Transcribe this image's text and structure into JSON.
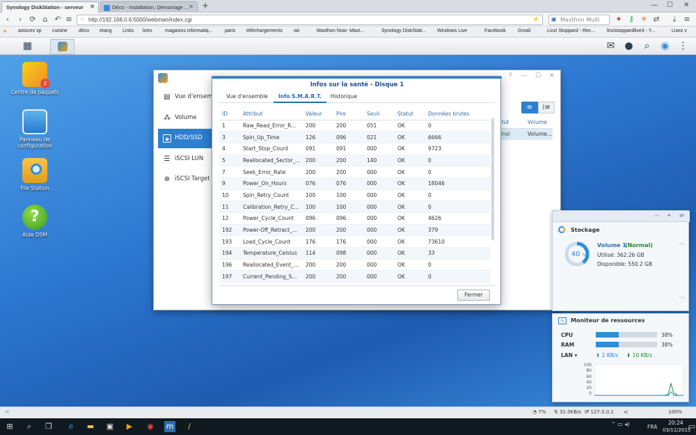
{
  "browser": {
    "tabs": [
      {
        "label": "Synology DiskStation - serveur",
        "active": true
      },
      {
        "label": "Déco - Installation, Démarrage ...",
        "active": false
      }
    ],
    "url": "http://192.168.0.6:5000/webman/index.cgi",
    "search_placeholder": "Maxthon Multi",
    "bookmarks": [
      "astuces xp",
      "cuisine",
      "déco",
      "etang",
      "Links",
      "lotro",
      "magasins informatiq...",
      "paris",
      "téléchargements",
      "wii",
      "Maxthon Now- Maxt...",
      "Synology DiskStati...",
      "Windows Live",
      "Facebook",
      "Gmail",
      "Linzi Stoppard - Rec...",
      "linzistoppardlive3 - Y...",
      "Lisez v"
    ]
  },
  "desktop": {
    "icons": [
      {
        "label": "Centre de paquets",
        "badge": "2"
      },
      {
        "label": "Panneau de configuration"
      },
      {
        "label": "File Station"
      },
      {
        "label": "Aide DSM"
      }
    ]
  },
  "storage_window": {
    "sidebar": [
      "Vue d'ensem",
      "Volume",
      "HDD/SSD",
      "iSCSI LUN",
      "iSCSI Target"
    ],
    "active_index": 2,
    "table_headers": [
      "atut",
      "Volume"
    ],
    "table_row": [
      "rmal",
      "Volume..."
    ]
  },
  "dialog": {
    "title": "Infos sur la santé - Disque 1",
    "tabs": [
      "Vue d'ensemble",
      "Info S.M.A.R.T.",
      "Historique"
    ],
    "active_tab": 1,
    "columns": [
      "ID",
      "Attribut",
      "Valeur",
      "Pire",
      "Seuil",
      "Statut",
      "Données brutes"
    ],
    "rows": [
      [
        "1",
        "Raw_Read_Error_R...",
        "200",
        "200",
        "051",
        "OK",
        "0"
      ],
      [
        "3",
        "Spin_Up_Time",
        "126",
        "096",
        "021",
        "OK",
        "6666"
      ],
      [
        "4",
        "Start_Stop_Count",
        "091",
        "091",
        "000",
        "OK",
        "9723"
      ],
      [
        "5",
        "Reallocated_Sector_...",
        "200",
        "200",
        "140",
        "OK",
        "0"
      ],
      [
        "7",
        "Seek_Error_Rate",
        "200",
        "200",
        "000",
        "OK",
        "0"
      ],
      [
        "9",
        "Power_On_Hours",
        "076",
        "076",
        "000",
        "OK",
        "18046"
      ],
      [
        "10",
        "Spin_Retry_Count",
        "100",
        "100",
        "000",
        "OK",
        "0"
      ],
      [
        "11",
        "Calibration_Retry_C...",
        "100",
        "100",
        "000",
        "OK",
        "0"
      ],
      [
        "12",
        "Power_Cycle_Count",
        "096",
        "096",
        "000",
        "OK",
        "4626"
      ],
      [
        "192",
        "Power-Off_Retract_...",
        "200",
        "200",
        "000",
        "OK",
        "379"
      ],
      [
        "193",
        "Load_Cycle_Count",
        "176",
        "176",
        "000",
        "OK",
        "73610"
      ],
      [
        "194",
        "Temperature_Celsius",
        "114",
        "098",
        "000",
        "OK",
        "33"
      ],
      [
        "196",
        "Reallocated_Event_...",
        "200",
        "200",
        "000",
        "OK",
        "0"
      ],
      [
        "197",
        "Current_Pending_S...",
        "200",
        "200",
        "000",
        "OK",
        "0"
      ]
    ],
    "close_label": "Fermer"
  },
  "storage_widget": {
    "title": "Stockage",
    "percent": "40",
    "percent_unit": "%",
    "percent_value": 40,
    "volume_name": "Volume 1",
    "volume_status": "(Normal)",
    "used": "Utilisé: 362.26 GB",
    "available": "Disponible: 550.2 GB"
  },
  "resource_widget": {
    "title": "Moniteur de ressources",
    "cpu_label": "CPU",
    "cpu_value": "38%",
    "cpu_fraction": 0.38,
    "ram_label": "RAM",
    "ram_value": "38%",
    "ram_fraction": 0.38,
    "lan_label": "LAN",
    "lan_up": "2 KB/s",
    "lan_down": "10 KB/s",
    "chart_ticks": [
      "100",
      "80",
      "60",
      "40",
      "20",
      "0"
    ]
  },
  "statusbar": {
    "zoom": "100%",
    "net": "7%",
    "speed": "31.0KB/s",
    "ip": "IP 127.0.0.1"
  },
  "taskbar": {
    "lang": "FRA",
    "time": "20:24",
    "date": "03/11/2015"
  },
  "colors": {
    "accent": "#2d7fcf",
    "normal_status": "#1d8a2a",
    "desktop": "#2d78d1"
  }
}
